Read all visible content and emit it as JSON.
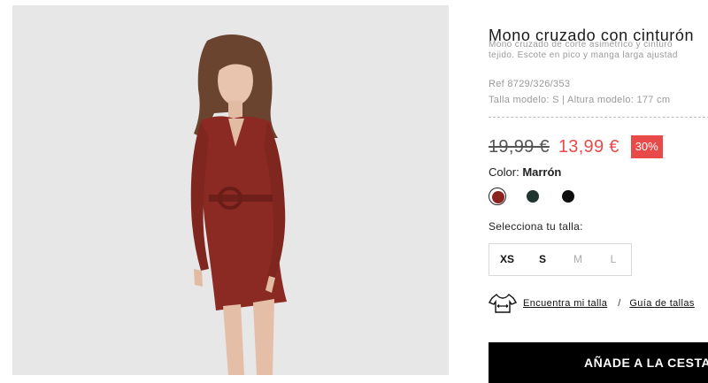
{
  "product": {
    "title": "Mono cruzado con cinturón",
    "description_line1": "Mono cruzado de corte asimétrico y cinturó",
    "description_line2": "tejido. Escote en pico y manga larga ajustad",
    "ref": "Ref 8729/326/353",
    "model_info": "Talla modelo: S | Altura modelo: 177 cm"
  },
  "pricing": {
    "old_price": "19,99 €",
    "new_price": "13,99 €",
    "discount_badge": "30%"
  },
  "color": {
    "label": "Color:",
    "selected": "Marrón",
    "swatches": [
      {
        "name": "marron",
        "hex": "#8b2420",
        "selected": true
      },
      {
        "name": "verde-oscuro",
        "hex": "#1e3530",
        "selected": false
      },
      {
        "name": "negro",
        "hex": "#0d0d0d",
        "selected": false
      }
    ]
  },
  "size": {
    "prompt": "Selecciona tu talla:",
    "options": [
      {
        "label": "XS",
        "available": true
      },
      {
        "label": "S",
        "available": true
      },
      {
        "label": "M",
        "available": false
      },
      {
        "label": "L",
        "available": false
      }
    ]
  },
  "fit": {
    "icon": "tshirt-ruler-icon",
    "find_size": "Encuentra mi talla",
    "separator": "/",
    "size_guide": "Guía de tallas"
  },
  "cart": {
    "button_label": "AÑADE A LA CESTA"
  },
  "colors": {
    "accent_red": "#e84a4a",
    "garment": "#8b2a22"
  }
}
